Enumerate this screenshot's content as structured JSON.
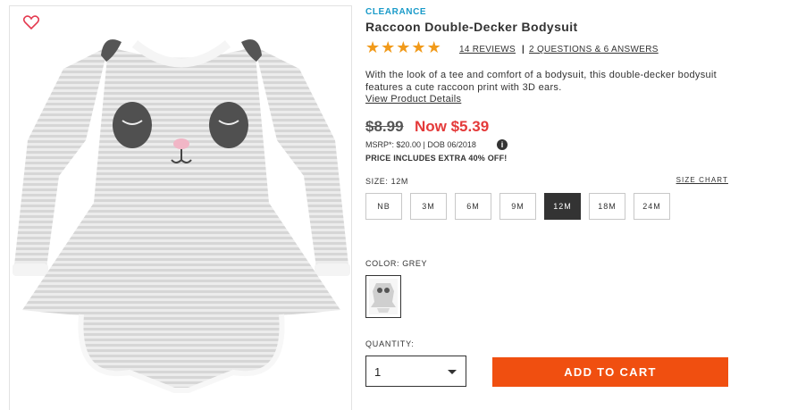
{
  "product": {
    "badge": "CLEARANCE",
    "title": "Raccoon Double-Decker Bodysuit",
    "rating": 5,
    "rating_stars": [
      "★",
      "★",
      "★",
      "★",
      "★"
    ],
    "reviews_link": "14 REVIEWS",
    "divider": "|",
    "qa_link": "2 QUESTIONS & 6 ANSWERS",
    "description": "With the look of a tee and comfort of a bodysuit, this double-decker bodysuit features a cute raccoon print with 3D ears.",
    "view_details_link": "View Product Details"
  },
  "pricing": {
    "original_price": "$8.99",
    "now_price": "Now $5.39",
    "msrp_line": "MSRP*: $20.00 | DOB 06/2018",
    "info_icon": "i",
    "promo": "PRICE INCLUDES EXTRA 40% OFF!"
  },
  "size": {
    "label": "SIZE: 12M",
    "chart_link": "SIZE CHART",
    "options": [
      "NB",
      "3M",
      "6M",
      "9M",
      "12M",
      "18M",
      "24M"
    ],
    "selected": "12M"
  },
  "color": {
    "label": "COLOR: GREY",
    "swatch": "grey-raccoon-swatch"
  },
  "quantity": {
    "label": "QUANTITY:",
    "value": "1"
  },
  "cart": {
    "add_label": "ADD TO CART"
  },
  "icons": {
    "favorite": "heart-icon",
    "info": "info-icon",
    "dropdown": "chevron-down-icon"
  },
  "colors": {
    "badge": "#1a9bc9",
    "star": "#f19a1a",
    "now_price": "#e43a3a",
    "cta": "#f04f10",
    "selected_size": "#333333"
  }
}
